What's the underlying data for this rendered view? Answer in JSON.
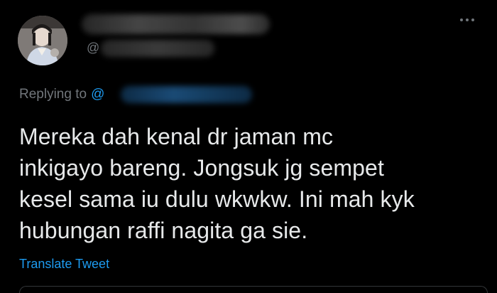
{
  "author": {
    "avatar": "profile-photo",
    "handle_prefix": "@"
  },
  "header": {
    "more_icon": "more-horizontal-icon"
  },
  "reply": {
    "prefix": "Replying to",
    "at": "@"
  },
  "tweet": {
    "text": "Mereka dah kenal dr jaman mc\ninkigayo bareng. Jongsuk jg sempet\nkesel sama iu dulu wkwkw. Ini mah kyk\nhubungan raffi nagita ga sie.",
    "translate_label": "Translate Tweet"
  },
  "colors": {
    "background": "#000000",
    "text": "#e7e9ea",
    "secondary": "#71767b",
    "accent": "#1d9bf0"
  }
}
